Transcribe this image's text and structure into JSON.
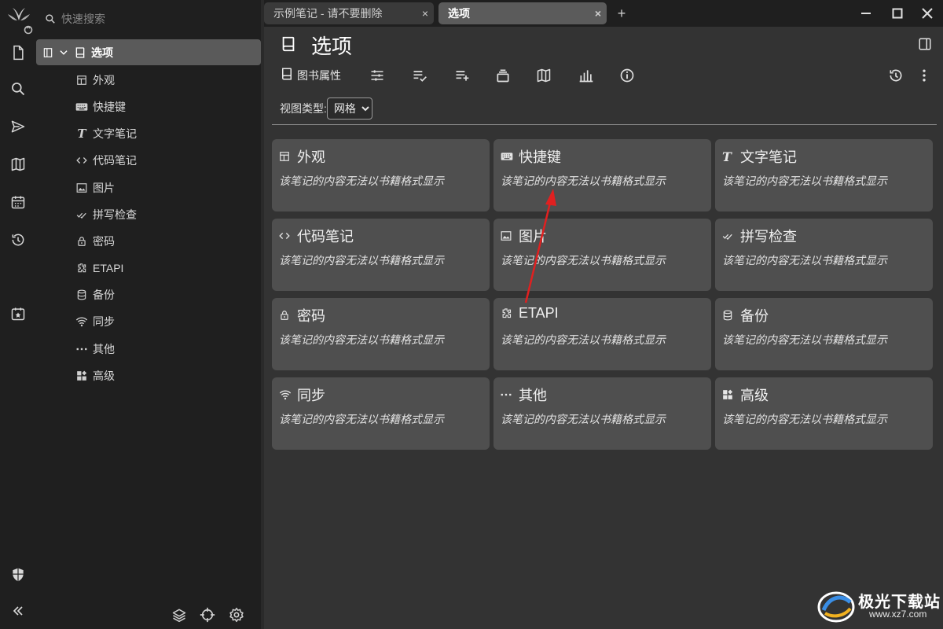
{
  "app": {
    "logo": "trilium-tree-logo",
    "sync_icon": "sync-icon"
  },
  "search": {
    "placeholder": "快速搜索"
  },
  "tree": {
    "root": {
      "label": "选项",
      "icon": "book-icon"
    },
    "items": [
      {
        "label": "外观",
        "icon": "layout-icon"
      },
      {
        "label": "快捷键",
        "icon": "keyboard-icon"
      },
      {
        "label": "文字笔记",
        "icon": "text-icon"
      },
      {
        "label": "代码笔记",
        "icon": "code-icon"
      },
      {
        "label": "图片",
        "icon": "image-icon"
      },
      {
        "label": "拼写检查",
        "icon": "spellcheck-icon"
      },
      {
        "label": "密码",
        "icon": "lock-icon"
      },
      {
        "label": "ETAPI",
        "icon": "extension-icon"
      },
      {
        "label": "备份",
        "icon": "database-icon"
      },
      {
        "label": "同步",
        "icon": "wifi-icon"
      },
      {
        "label": "其他",
        "icon": "dots-icon"
      },
      {
        "label": "高级",
        "icon": "widgets-icon"
      }
    ]
  },
  "tabs": [
    {
      "title": "示例笔记 - 请不要删除",
      "close": "×"
    },
    {
      "title": "选项",
      "close": "×"
    }
  ],
  "new_tab": "+",
  "note": {
    "title": "选项",
    "ribbon": {
      "book_properties": "图书属性"
    },
    "view_type_label": "视图类型:",
    "view_type_value": "网格",
    "cards": [
      {
        "title": "外观",
        "icon": "layout-icon"
      },
      {
        "title": "快捷键",
        "icon": "keyboard-icon"
      },
      {
        "title": "文字笔记",
        "icon": "text-icon"
      },
      {
        "title": "代码笔记",
        "icon": "code-icon"
      },
      {
        "title": "图片",
        "icon": "image-icon"
      },
      {
        "title": "拼写检查",
        "icon": "spellcheck-icon"
      },
      {
        "title": "密码",
        "icon": "lock-icon"
      },
      {
        "title": "ETAPI",
        "icon": "extension-icon"
      },
      {
        "title": "备份",
        "icon": "database-icon"
      },
      {
        "title": "同步",
        "icon": "wifi-icon"
      },
      {
        "title": "其他",
        "icon": "dots-icon"
      },
      {
        "title": "高级",
        "icon": "widgets-icon"
      }
    ],
    "card_description": "该笔记的内容无法以书籍格式显示"
  },
  "watermark": {
    "text": "极光下载站",
    "url": "www.xz7.com"
  },
  "colors": {
    "sidebar_bg": "#1f1f1f",
    "main_bg": "#333333",
    "card_bg": "#4f4f4f",
    "active_tab": "#5b5b5b",
    "arrow": "#e02020"
  }
}
